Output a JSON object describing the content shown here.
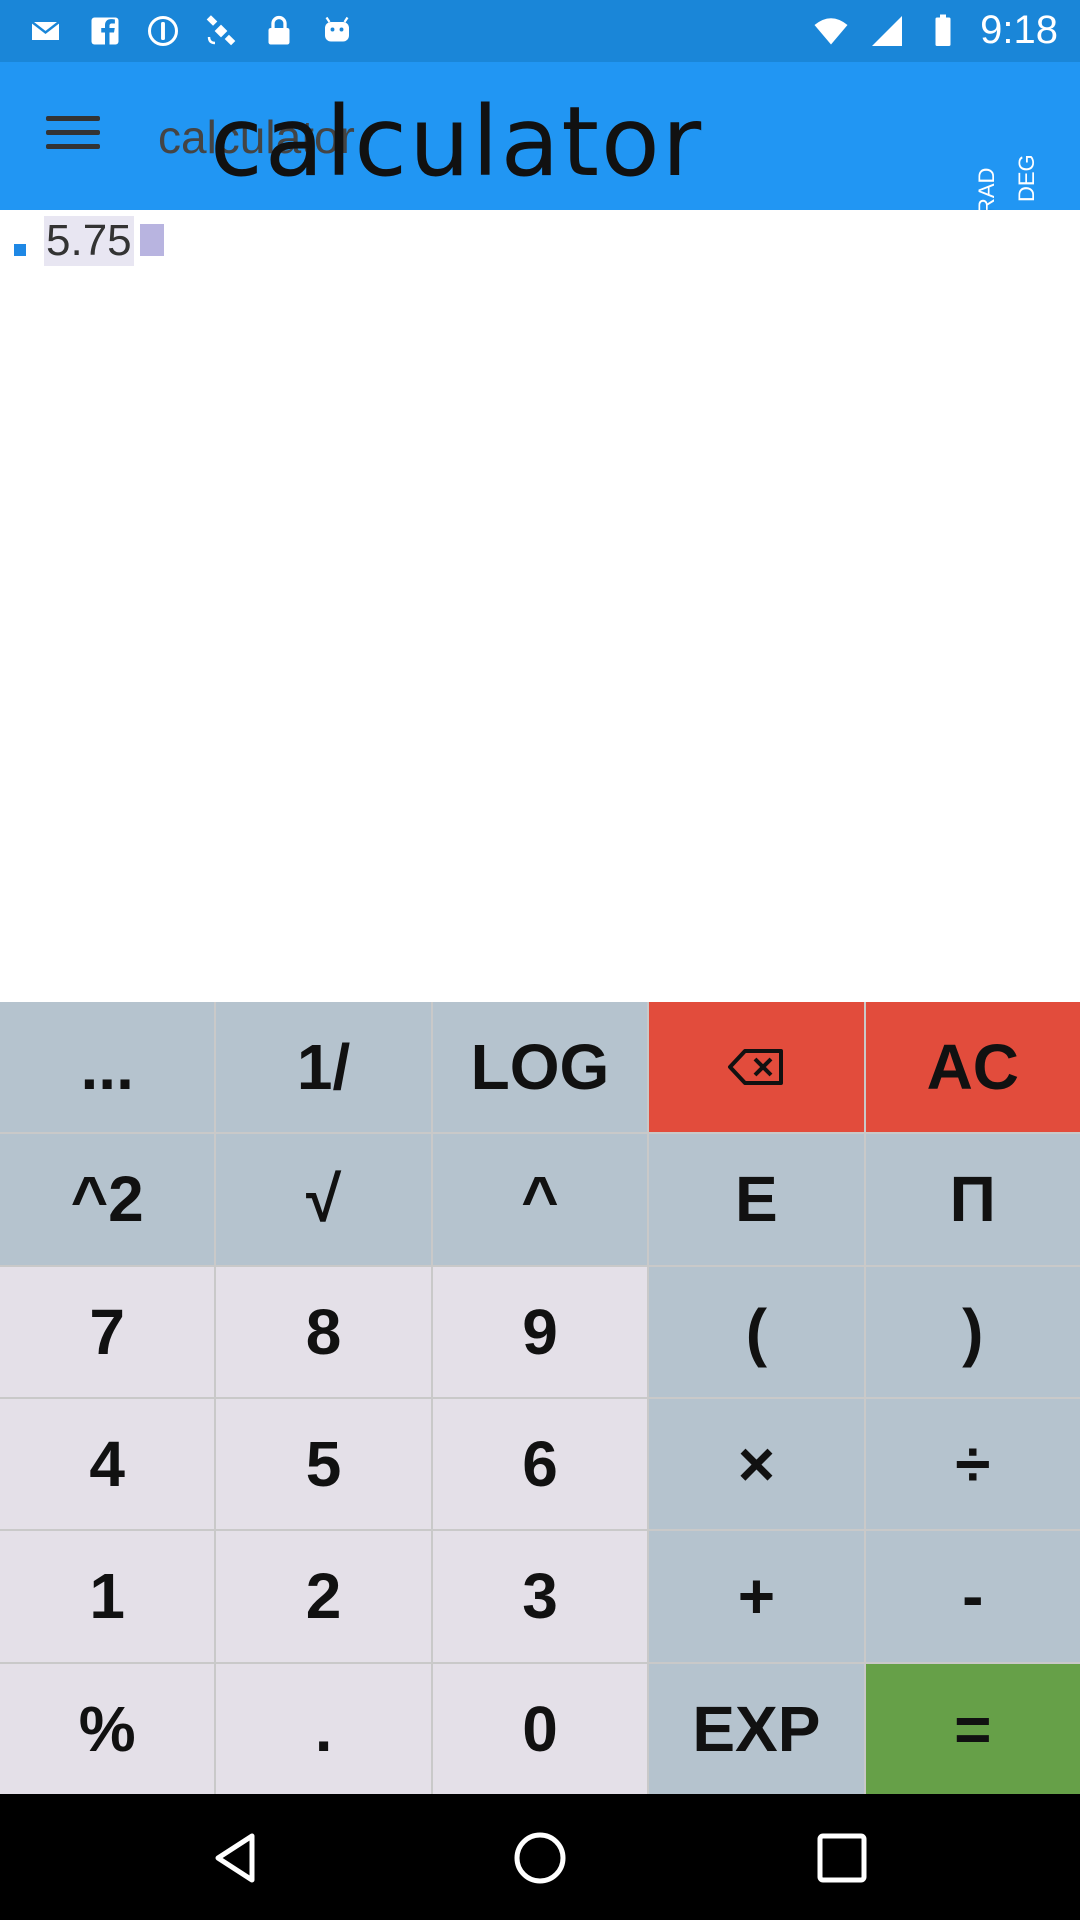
{
  "status_bar": {
    "time": "9:18",
    "icons": [
      "mail-icon",
      "facebook-icon",
      "info-icon",
      "satellite-icon",
      "lock-icon",
      "android-icon"
    ],
    "right_icons": [
      "wifi-icon",
      "signal-icon",
      "battery-icon"
    ]
  },
  "app_bar": {
    "title": "calculator",
    "logo_text": "calculator",
    "angle_toggle": {
      "rad_label": "RAD",
      "deg_label": "DEG",
      "selected": "RAD"
    }
  },
  "display": {
    "expression": "5.75"
  },
  "keypad": {
    "rows": [
      [
        "...",
        "1/",
        "LOG",
        "",
        "AC"
      ],
      [
        "^2",
        "√",
        "^",
        "E",
        "Π"
      ],
      [
        "7",
        "8",
        "9",
        "(",
        ")"
      ],
      [
        "4",
        "5",
        "6",
        "×",
        "÷"
      ],
      [
        "1",
        "2",
        "3",
        "+",
        "-"
      ],
      [
        "%",
        ".",
        "0",
        "EXP",
        "="
      ]
    ],
    "backspace_icon": "backspace-icon"
  },
  "colors": {
    "status_bar": "#1a86d8",
    "app_bar": "#2196f3",
    "function_key": "#b5c3ce",
    "number_key": "#e4e0e8",
    "clear_keys": "#e24c3c",
    "equals_key": "#66a048"
  }
}
